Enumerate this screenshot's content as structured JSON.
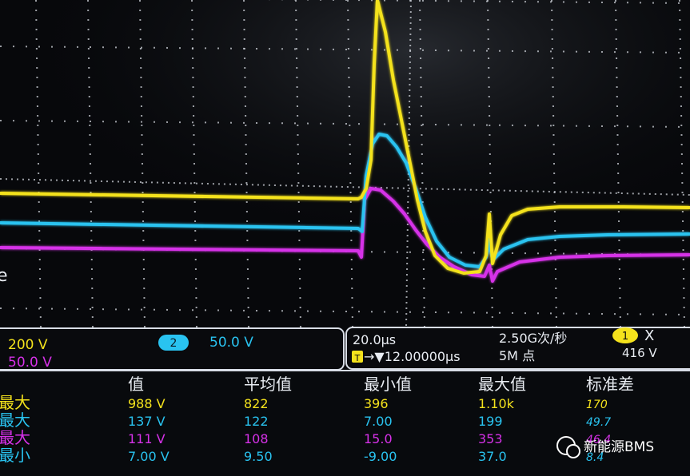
{
  "scope": {
    "colors": {
      "ch1": "#f4e21c",
      "ch2": "#29c3f0",
      "ch3": "#d631e8",
      "grid": "#cfd3da",
      "panel_border": "#d8dde6",
      "text_white": "#e9edf3"
    },
    "left_marker": "e",
    "channels": {
      "ch1_scale": "200 V",
      "ch3_scale": "50.0 V",
      "ch2_badge": "2",
      "ch2_scale": "50.0 V"
    },
    "timebase": {
      "time_div": "20.0μs",
      "sample_rate": "2.50G次/秒",
      "record_length": "5M 点",
      "trigger_icon": "T",
      "trigger_delay": "→▼12.00000μs",
      "trigger_channel": "1",
      "trigger_slope": "X",
      "trigger_level": "416 V"
    },
    "measurements": {
      "headers": [
        "值",
        "平均值",
        "最小值",
        "最大值",
        "标准差"
      ],
      "rows": [
        {
          "label": "最大",
          "value": "988 V",
          "mean": "822",
          "min": "396",
          "max": "1.10k",
          "std": "170"
        },
        {
          "label": "最大",
          "value": "137 V",
          "mean": "122",
          "min": "7.00",
          "max": "199",
          "std": "49.7"
        },
        {
          "label": "最大",
          "value": "111 V",
          "mean": "108",
          "min": "15.0",
          "max": "353",
          "std": "46.4"
        },
        {
          "label": "最小",
          "value": "7.00 V",
          "mean": "9.50",
          "min": "-9.00",
          "max": "37.0",
          "std": "8.4"
        }
      ]
    },
    "watermark": "新能源BMS"
  }
}
